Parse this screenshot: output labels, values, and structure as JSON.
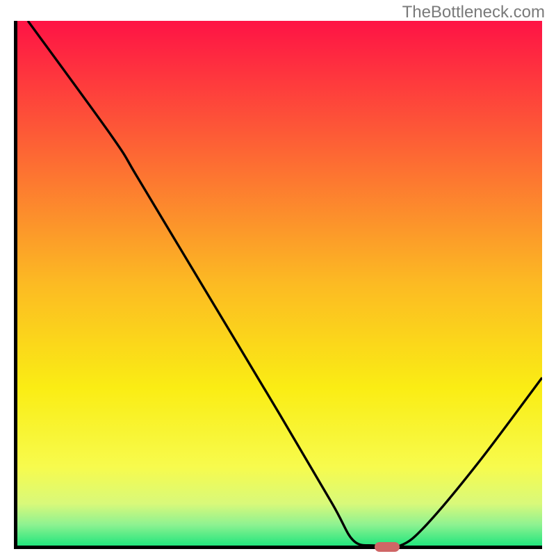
{
  "watermark": "TheBottleneck.com",
  "chart_data": {
    "type": "line",
    "title": "",
    "xlabel": "",
    "ylabel": "",
    "xlim": [
      0,
      100
    ],
    "ylim": [
      0,
      100
    ],
    "background_gradient": {
      "orientation": "vertical",
      "stops": [
        {
          "pct": 0,
          "color": "#fe1345"
        },
        {
          "pct": 25,
          "color": "#fd6634"
        },
        {
          "pct": 50,
          "color": "#fcba23"
        },
        {
          "pct": 70,
          "color": "#faed14"
        },
        {
          "pct": 85,
          "color": "#f7fb4d"
        },
        {
          "pct": 92,
          "color": "#d9f97a"
        },
        {
          "pct": 96,
          "color": "#8ef291"
        },
        {
          "pct": 100,
          "color": "#22e57d"
        }
      ]
    },
    "series": [
      {
        "name": "bottleneck-curve",
        "color": "#000000",
        "points": [
          {
            "x": 2,
            "y": 100
          },
          {
            "x": 18,
            "y": 78
          },
          {
            "x": 23,
            "y": 70
          },
          {
            "x": 35,
            "y": 50
          },
          {
            "x": 50,
            "y": 25
          },
          {
            "x": 60,
            "y": 8
          },
          {
            "x": 64,
            "y": 1
          },
          {
            "x": 68,
            "y": 0
          },
          {
            "x": 73,
            "y": 0
          },
          {
            "x": 78,
            "y": 4
          },
          {
            "x": 88,
            "y": 16
          },
          {
            "x": 100,
            "y": 32
          }
        ]
      }
    ],
    "marker": {
      "x": 70,
      "y": 0,
      "color": "#cf6666"
    }
  }
}
